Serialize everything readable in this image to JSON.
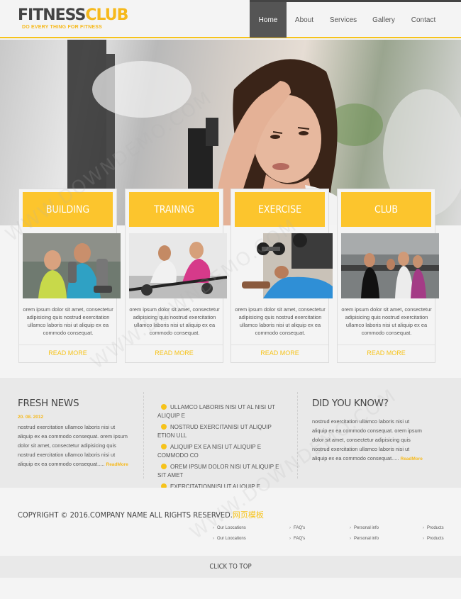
{
  "brand": {
    "name_part1": "FITNESS",
    "name_part2": "CLUB",
    "tagline": "DO EVERY THING FOR FITNESS"
  },
  "nav": {
    "items": [
      {
        "label": "Home",
        "active": true
      },
      {
        "label": "About",
        "active": false
      },
      {
        "label": "Services",
        "active": false
      },
      {
        "label": "Gallery",
        "active": false
      },
      {
        "label": "Contact",
        "active": false
      }
    ]
  },
  "features": [
    {
      "title": "BUILDING",
      "text": "orem ipsum dolor sit amet, consectetur adipisicing quis nostrud exercitation ullamco laboris nisi ut aliquip ex ea commodo consequat.",
      "link": "READ MORE"
    },
    {
      "title": "TRAINNG",
      "text": "orem ipsum dolor sit amet, consectetur adipisicing quis nostrud exercitation ullamco laboris nisi ut aliquip ex ea commodo consequat.",
      "link": "READ MORE"
    },
    {
      "title": "EXERCISE",
      "text": "orem ipsum dolor sit amet, consectetur adipisicing quis nostrud exercitation ullamco laboris nisi ut aliquip ex ea commodo consequat.",
      "link": "READ MORE"
    },
    {
      "title": "CLUB",
      "text": "orem ipsum dolor sit amet, consectetur adipisicing quis nostrud exercitation ullamco laboris nisi ut aliquip ex ea commodo consequat.",
      "link": "READ MORE"
    }
  ],
  "news": {
    "title": "FRESH NEWS",
    "date": "20. 08. 2012",
    "text": "nostrud exercitation ullamco laboris nisi ut aliquip ex ea commodo consequat. orem ipsum dolor sit amet, consectetur adipisicing quis nostrud exercitation ullamco laboris nisi ut aliquip ex ea commodo consequat.....",
    "read_more": "ReadMore"
  },
  "list": [
    "ULLAMCO LABORIS NISI UT AL NISI UT ALIQUIP E",
    "NOSTRUD EXERCITANISI UT ALIQUIP ETION ULL",
    "ALIQUIP EX EA NISI UT ALIQUIP E COMMODO CO",
    "OREM IPSUM DOLOR NISI UT ALIQUIP E SIT AMET",
    "EXERCITATIONNISI UT ALIQUIP E ULLAMCO LABORIS"
  ],
  "know": {
    "title": "DID YOU KNOW?",
    "text": "nostrud exercitation ullamco laboris nisi ut aliquip ex ea commodo consequat. orem ipsum dolor sit amet, consectetur adipisicing quis nostrud exercitation ullamco laboris nisi ut aliquip ex ea commodo consequat.....",
    "read_more": "ReadMore"
  },
  "footer": {
    "copyright": "COPYRIGHT © 2016.COMPANY NAME ALL RIGHTS RESERVED.",
    "copyright_cn": "网页模板",
    "links_row1": [
      "Our Loocations",
      "FAQ's",
      "Personal info",
      "Products"
    ],
    "links_row2": [
      "Our Loocations",
      "FAQ's",
      "Personal info",
      "Products"
    ],
    "to_top": "CLICK TO TOP"
  },
  "watermark": "WWW.DOWNDEMO.COM",
  "colors": {
    "accent": "#f6c31b",
    "tab_yellow": "#fcc52d",
    "dark": "#444444",
    "nav_active": "#555555"
  }
}
